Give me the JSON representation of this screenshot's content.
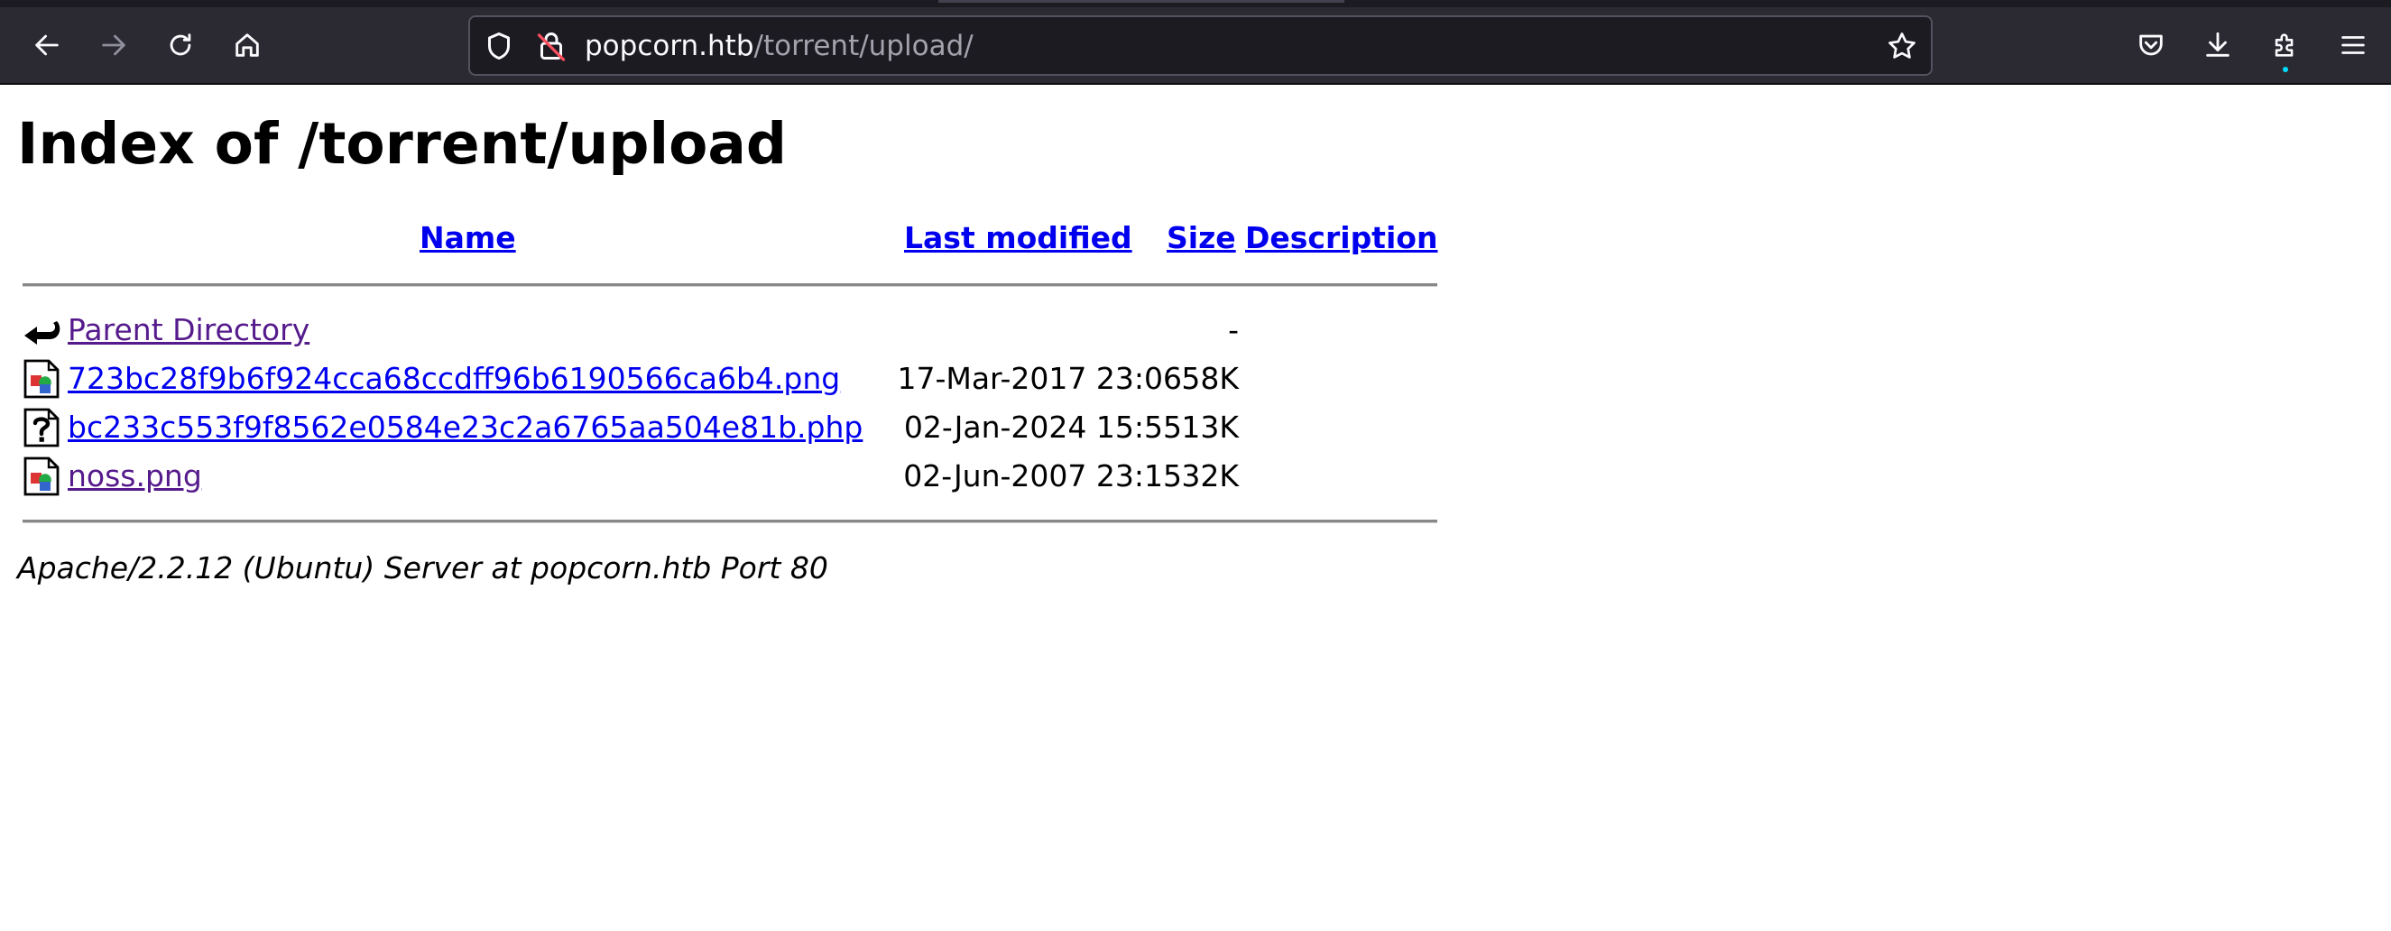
{
  "browser": {
    "url_host": "popcorn.htb",
    "url_path": "/torrent/upload/",
    "icons": {
      "back": "back-arrow-icon",
      "forward": "forward-arrow-icon",
      "reload": "reload-icon",
      "home": "home-icon",
      "shield": "tracking-protection-shield-icon",
      "lock": "insecure-lock-icon",
      "bookmark": "bookmark-star-icon",
      "pocket": "pocket-icon",
      "downloads": "downloads-icon",
      "extensions": "extensions-icon",
      "menu": "hamburger-menu-icon"
    },
    "colors": {
      "toolbar_bg": "#2b2a33",
      "urlbar_bg": "#1c1b22",
      "extension_dot": "#00ddff"
    }
  },
  "page": {
    "title": "Index of /torrent/upload",
    "columns": {
      "name": "Name",
      "last_modified": "Last modified",
      "size": "Size",
      "description": "Description"
    },
    "rows": [
      {
        "icon": "back-folder-icon",
        "name": "Parent Directory",
        "date": "",
        "size": "-",
        "visited": true
      },
      {
        "icon": "image-file-icon",
        "name": "723bc28f9b6f924cca68ccdff96b6190566ca6b4.png",
        "date": "17-Mar-2017 23:06",
        "size": "58K",
        "visited": false
      },
      {
        "icon": "unknown-file-icon",
        "name": "bc233c553f9f8562e0584e23c2a6765aa504e81b.php",
        "date": "02-Jan-2024 15:55",
        "size": "13K",
        "visited": false
      },
      {
        "icon": "image-file-icon",
        "name": "noss.png",
        "date": "02-Jun-2007 23:15",
        "size": "32K",
        "visited": true
      }
    ],
    "footer": "Apache/2.2.12 (Ubuntu) Server at popcorn.htb Port 80",
    "colors": {
      "link": "#0000ee",
      "visited_link": "#551a8b"
    }
  }
}
